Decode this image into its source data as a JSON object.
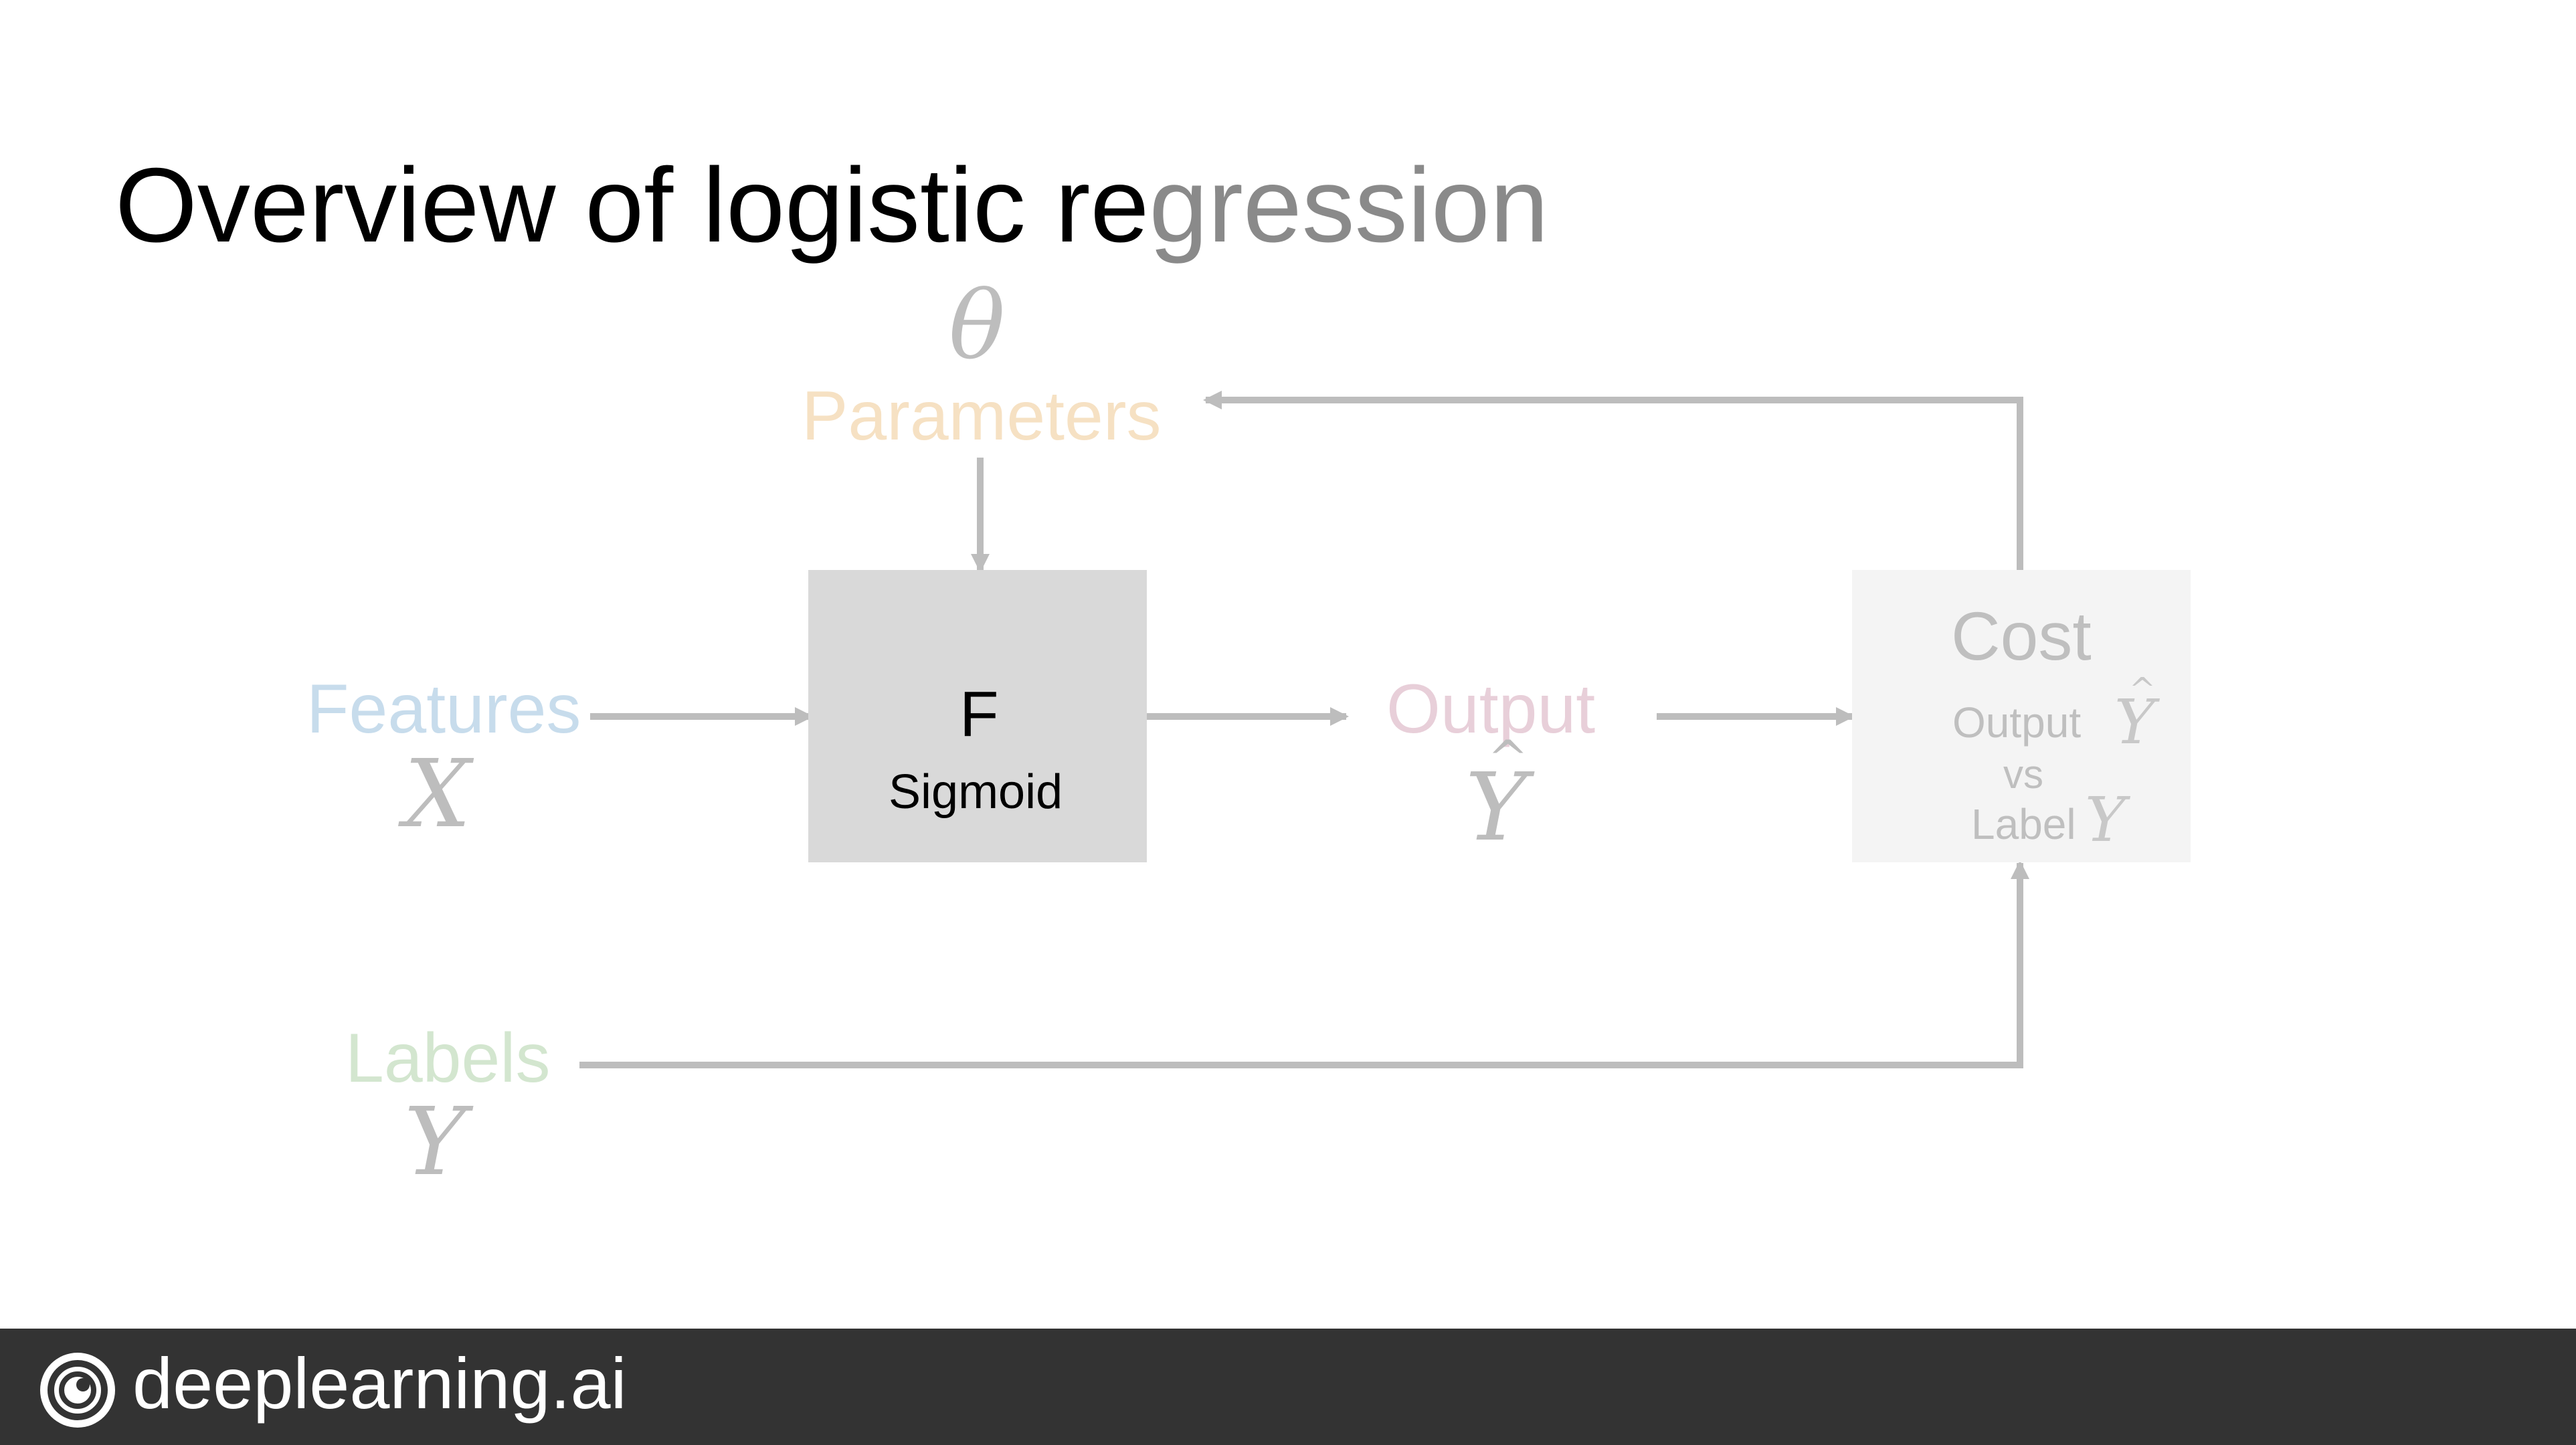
{
  "slide": {
    "title": {
      "dark": "Overview of logistic re",
      "faded": "gression"
    }
  },
  "diagram": {
    "parameters": {
      "symbol": "θ",
      "label": "Parameters",
      "color": "#f6e1c3"
    },
    "features": {
      "label": "Features",
      "symbol": "X",
      "color": "#c7dcec"
    },
    "labels": {
      "label": "Labels",
      "symbol": "Y",
      "color": "#d3e6cf"
    },
    "function_box": {
      "title": "F",
      "subtitle": "Sigmoid",
      "fill": "#d9d9d9"
    },
    "output": {
      "label": "Output",
      "symbol": "Y",
      "color": "#e8cfd9"
    },
    "cost": {
      "title": "Cost",
      "line1_text": "Output",
      "line1_symbol": "Y",
      "line2_text": "vs",
      "line3_text": "Label",
      "line3_symbol": "Y",
      "fill": "#f4f4f4",
      "text_color": "#bfbfbf"
    },
    "arrow_color": "#bdbdbd"
  },
  "footer": {
    "brand": "deeplearning.ai",
    "icon": "deeplearning-logo-icon",
    "background": "#333333"
  }
}
